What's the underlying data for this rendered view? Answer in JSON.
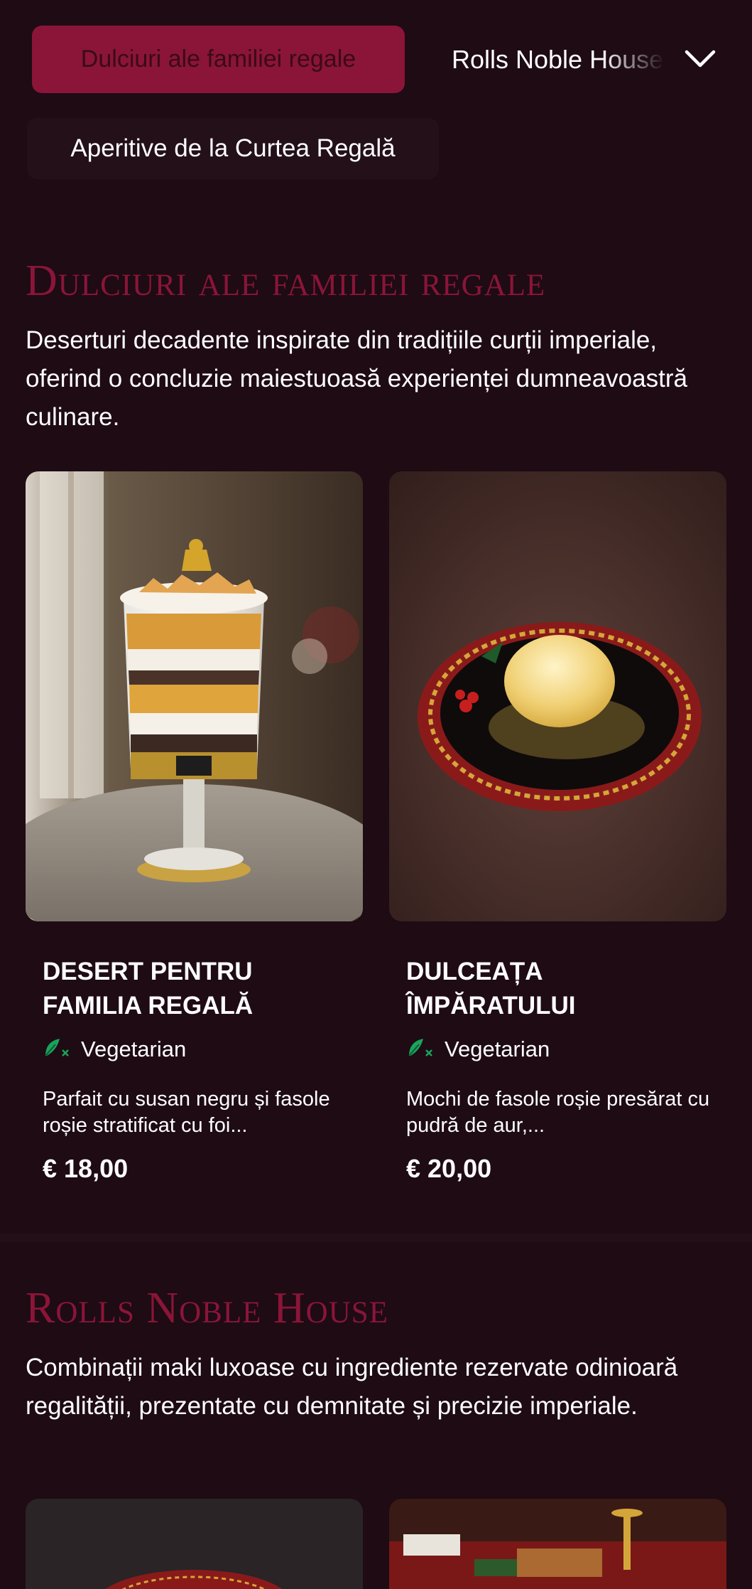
{
  "nav": {
    "active_chip": "Dulciuri ale familiei regale",
    "next_chip": "Rolls Noble House",
    "second_row_chip": "Aperitive de la Curtea Regală"
  },
  "sections": [
    {
      "title": "Dulciuri ale familiei regale",
      "description": "Deserturi decadente inspirate din tradițiile curții imperiale, oferind o concluzie maiestuoasă experienței dumneavoastră culinare.",
      "items": [
        {
          "name": "DESERT PENTRU FAMILIA REGALĂ",
          "tag": "Vegetarian",
          "description": "Parfait cu susan negru și fasole roșie stratificat cu foi...",
          "price": "€ 18,00"
        },
        {
          "name": "DULCEAȚA ÎMPĂRATULUI",
          "tag": "Vegetarian",
          "description": "Mochi de fasole roșie presărat cu pudră de aur,...",
          "price": "€ 20,00"
        }
      ]
    },
    {
      "title": "Rolls Noble House",
      "description": "Combinații maki luxoase cu ingrediente rezervate odinioară regalității, prezentate cu demnitate și precizie imperiale."
    }
  ],
  "colors": {
    "background": "#1e0b14",
    "accent": "#8a1538",
    "vegetarian_icon": "#1aa35b"
  },
  "icons": {
    "dropdown": "chevron-down-icon",
    "vegetarian": "leaf-icon"
  }
}
